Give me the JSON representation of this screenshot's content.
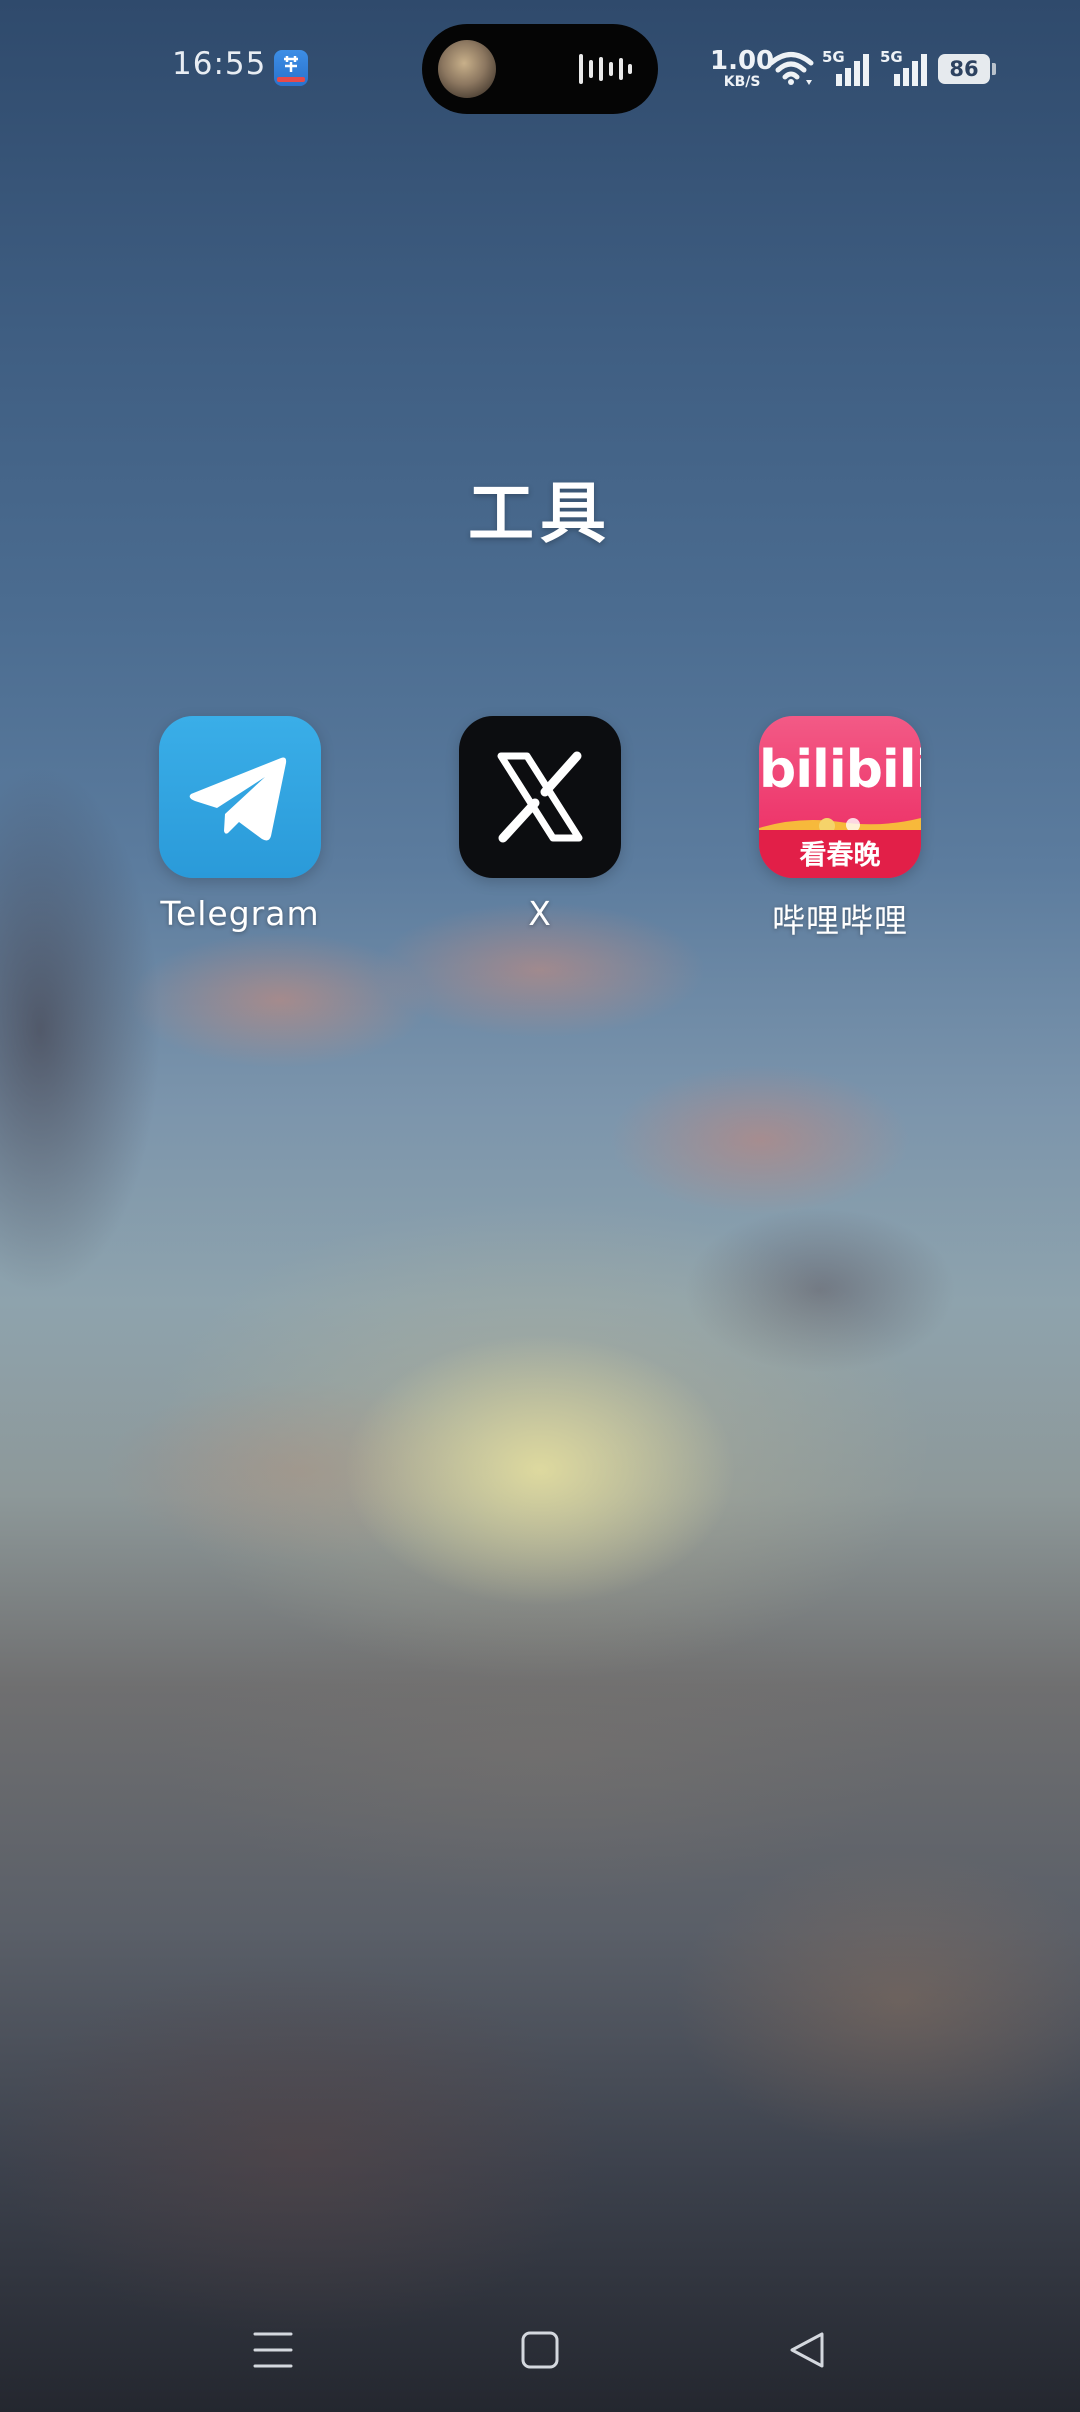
{
  "status_bar": {
    "time": "16:55",
    "notification_icon": "app-notification-icon",
    "net_speed_value": "1.00",
    "net_speed_unit": "KB/S",
    "signal_1_label": "5G",
    "signal_2_label": "5G",
    "battery_level": "86"
  },
  "folder": {
    "title": "工具",
    "apps": [
      {
        "label": "Telegram",
        "icon": "telegram-icon",
        "color": "#2ea6e0"
      },
      {
        "label": "X",
        "icon": "x-icon",
        "color": "#0c0d10"
      },
      {
        "label": "哔哩哔哩",
        "icon": "bilibili-icon",
        "color": "#ee3a6e",
        "icon_text": "bilibili",
        "icon_subtext": "看春晚"
      }
    ]
  },
  "nav_bar": {
    "menu": "menu-icon",
    "home": "home-icon",
    "back": "back-icon"
  }
}
